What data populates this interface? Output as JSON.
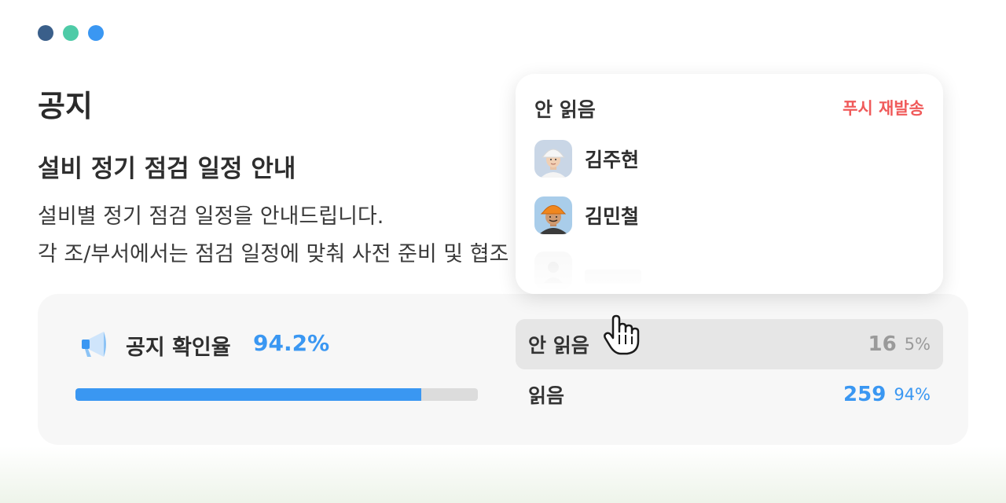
{
  "window_controls": {
    "colors": [
      "#3a5f8a",
      "#4ecba7",
      "#3a97f2"
    ]
  },
  "page": {
    "title": "공지"
  },
  "notice": {
    "title": "설비 정기 점검 일정 안내",
    "body_line1": "설비별 정기 점검 일정을 안내드립니다.",
    "body_line2": "각 조/부서에서는 점검 일정에 맞춰 사전 준비 및 협조 부탁드립니다."
  },
  "stats": {
    "rate_label": "공지 확인율",
    "rate_value": "94.2%",
    "progress_fraction": 0.86,
    "unread": {
      "label": "안 읽음",
      "count": "16",
      "percent": "5%"
    },
    "read": {
      "label": "읽음",
      "count": "259",
      "percent": "94%"
    }
  },
  "popup": {
    "title": "안 읽음",
    "resend_label": "푸시 재발송",
    "users": [
      {
        "name": "김주현",
        "helmet": "white"
      },
      {
        "name": "김민철",
        "helmet": "orange"
      }
    ]
  },
  "colors": {
    "accent": "#3a97f2",
    "danger": "#f05a5a",
    "muted": "#9a9a9a"
  }
}
